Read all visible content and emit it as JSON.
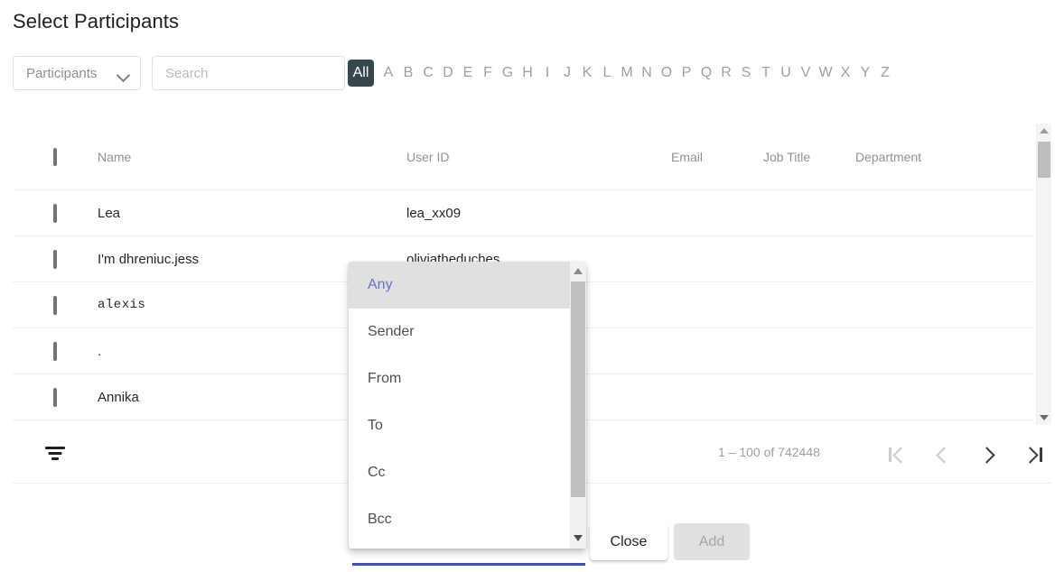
{
  "page_title": "Select Participants",
  "filter_bar": {
    "entity_select": {
      "value": "Participants",
      "icon": "chevron-down-icon"
    },
    "search": {
      "value": "",
      "placeholder": "Search"
    },
    "alpha_all_label": "All",
    "alphabet": [
      "A",
      "B",
      "C",
      "D",
      "E",
      "F",
      "G",
      "H",
      "I",
      "J",
      "K",
      "L",
      "M",
      "N",
      "O",
      "P",
      "Q",
      "R",
      "S",
      "T",
      "U",
      "V",
      "W",
      "X",
      "Y",
      "Z"
    ],
    "active_alpha": "All"
  },
  "table": {
    "headers": [
      "Name",
      "User ID",
      "Email",
      "Job Title",
      "Department"
    ],
    "rows": [
      {
        "name": "Lea",
        "user_id": "lea_xx09",
        "email": "",
        "job_title": "",
        "department": "",
        "mono": false,
        "checked": false
      },
      {
        "name": "I'm dhreniuc.jess",
        "user_id": "oliviatheduches",
        "email": "",
        "job_title": "",
        "department": "",
        "mono": false,
        "checked": false
      },
      {
        "name": "alexis",
        "user_id": "",
        "email": "",
        "job_title": "",
        "department": "",
        "mono": true,
        "checked": false
      },
      {
        "name": ".",
        "user_id": "",
        "email": "",
        "job_title": "",
        "department": "",
        "mono": false,
        "checked": false
      },
      {
        "name": "Annika",
        "user_id": "",
        "email": "",
        "job_title": "",
        "department": "",
        "mono": false,
        "checked": false
      }
    ]
  },
  "footer": {
    "filter_icon": "filter-list-icon",
    "range_text": "1 – 100 of 742448",
    "pager": {
      "first": {
        "icon": "first-page-icon",
        "enabled": false
      },
      "prev": {
        "icon": "chevron-left-icon",
        "enabled": false
      },
      "next": {
        "icon": "chevron-right-icon",
        "enabled": true
      },
      "last": {
        "icon": "last-page-icon",
        "enabled": true
      }
    }
  },
  "actions": {
    "close_label": "Close",
    "add_label": "Add",
    "add_disabled": true
  },
  "dropdown": {
    "options": [
      "Any",
      "Sender",
      "From",
      "To",
      "Cc",
      "Bcc"
    ],
    "selected": "Any",
    "scroll_up_icon": "scroll-arrow-up-icon",
    "scroll_down_icon": "scroll-arrow-down-icon"
  },
  "colors": {
    "accent_chip": "#37474F",
    "focus_underline": "#3F51B5",
    "selected_option_text": "#6B71C7",
    "selected_option_bg": "#E0E0E0"
  }
}
